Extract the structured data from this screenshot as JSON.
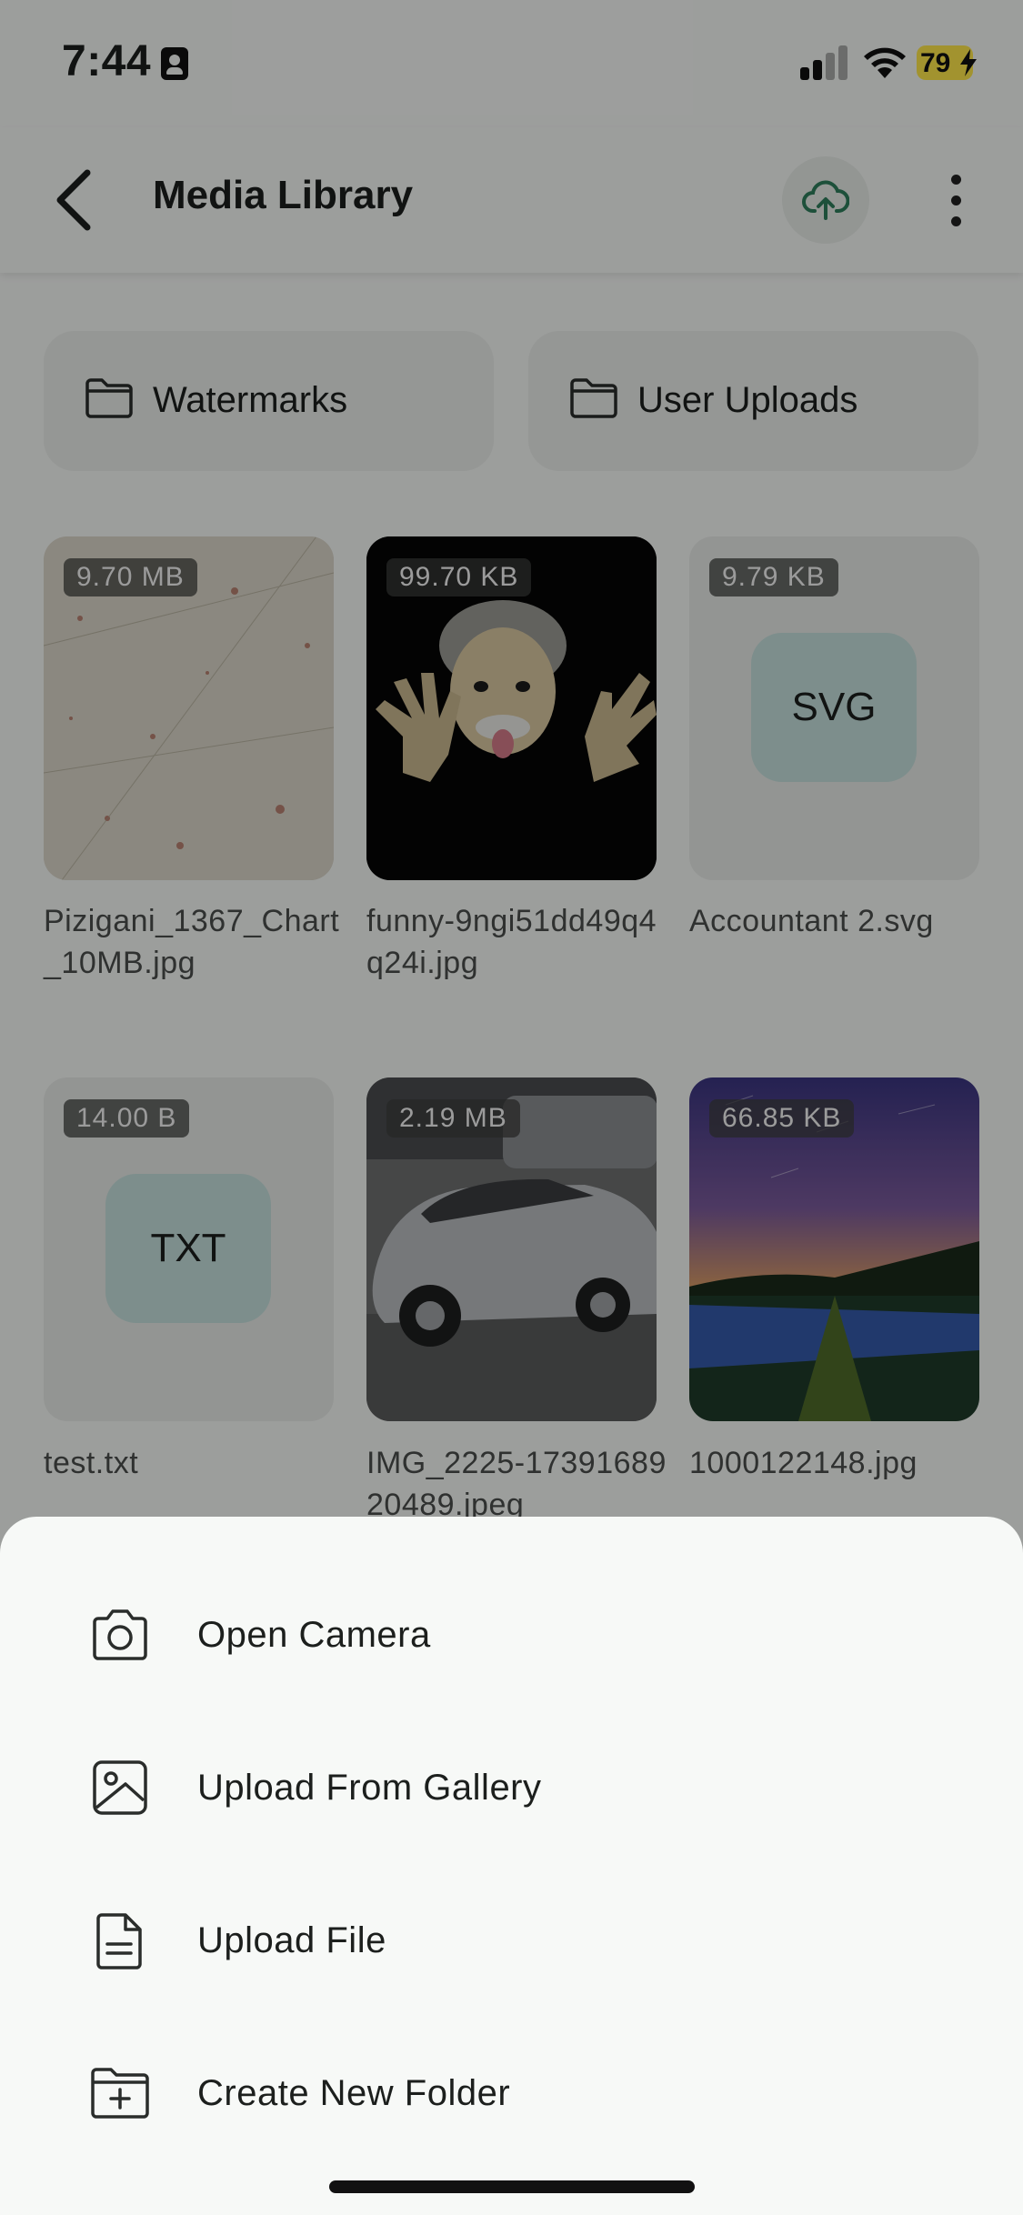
{
  "status_bar": {
    "time": "7:44",
    "battery": "79"
  },
  "header": {
    "title": "Media Library"
  },
  "folders": [
    {
      "label": "Watermarks"
    },
    {
      "label": "User Uploads"
    }
  ],
  "media": [
    {
      "size": "9.70 MB",
      "name": "Pizigani_1367_Chart_10MB.jpg",
      "kind": "image-map"
    },
    {
      "size": "99.70 KB",
      "name": "funny-9ngi51dd49q4q24i.jpg",
      "kind": "image-einstein"
    },
    {
      "size": "9.79 KB",
      "name": "Accountant 2.svg",
      "type_label": "SVG"
    },
    {
      "size": "14.00 B",
      "name": "test.txt",
      "type_label": "TXT"
    },
    {
      "size": "2.19 MB",
      "name": "IMG_2225-1739168920489.jpeg",
      "kind": "image-car"
    },
    {
      "size": "66.85 KB",
      "name": "1000122148.jpg",
      "kind": "image-field"
    }
  ],
  "sheet": {
    "items": [
      {
        "label": "Open Camera",
        "icon": "camera-icon"
      },
      {
        "label": "Upload From Gallery",
        "icon": "image-icon"
      },
      {
        "label": "Upload File",
        "icon": "file-icon"
      },
      {
        "label": "Create New Folder",
        "icon": "folder-plus-icon"
      }
    ]
  },
  "colors": {
    "accent": "#2e7d5b",
    "sheet_bg": "#f7f9f7",
    "battery": "#fde74a"
  }
}
